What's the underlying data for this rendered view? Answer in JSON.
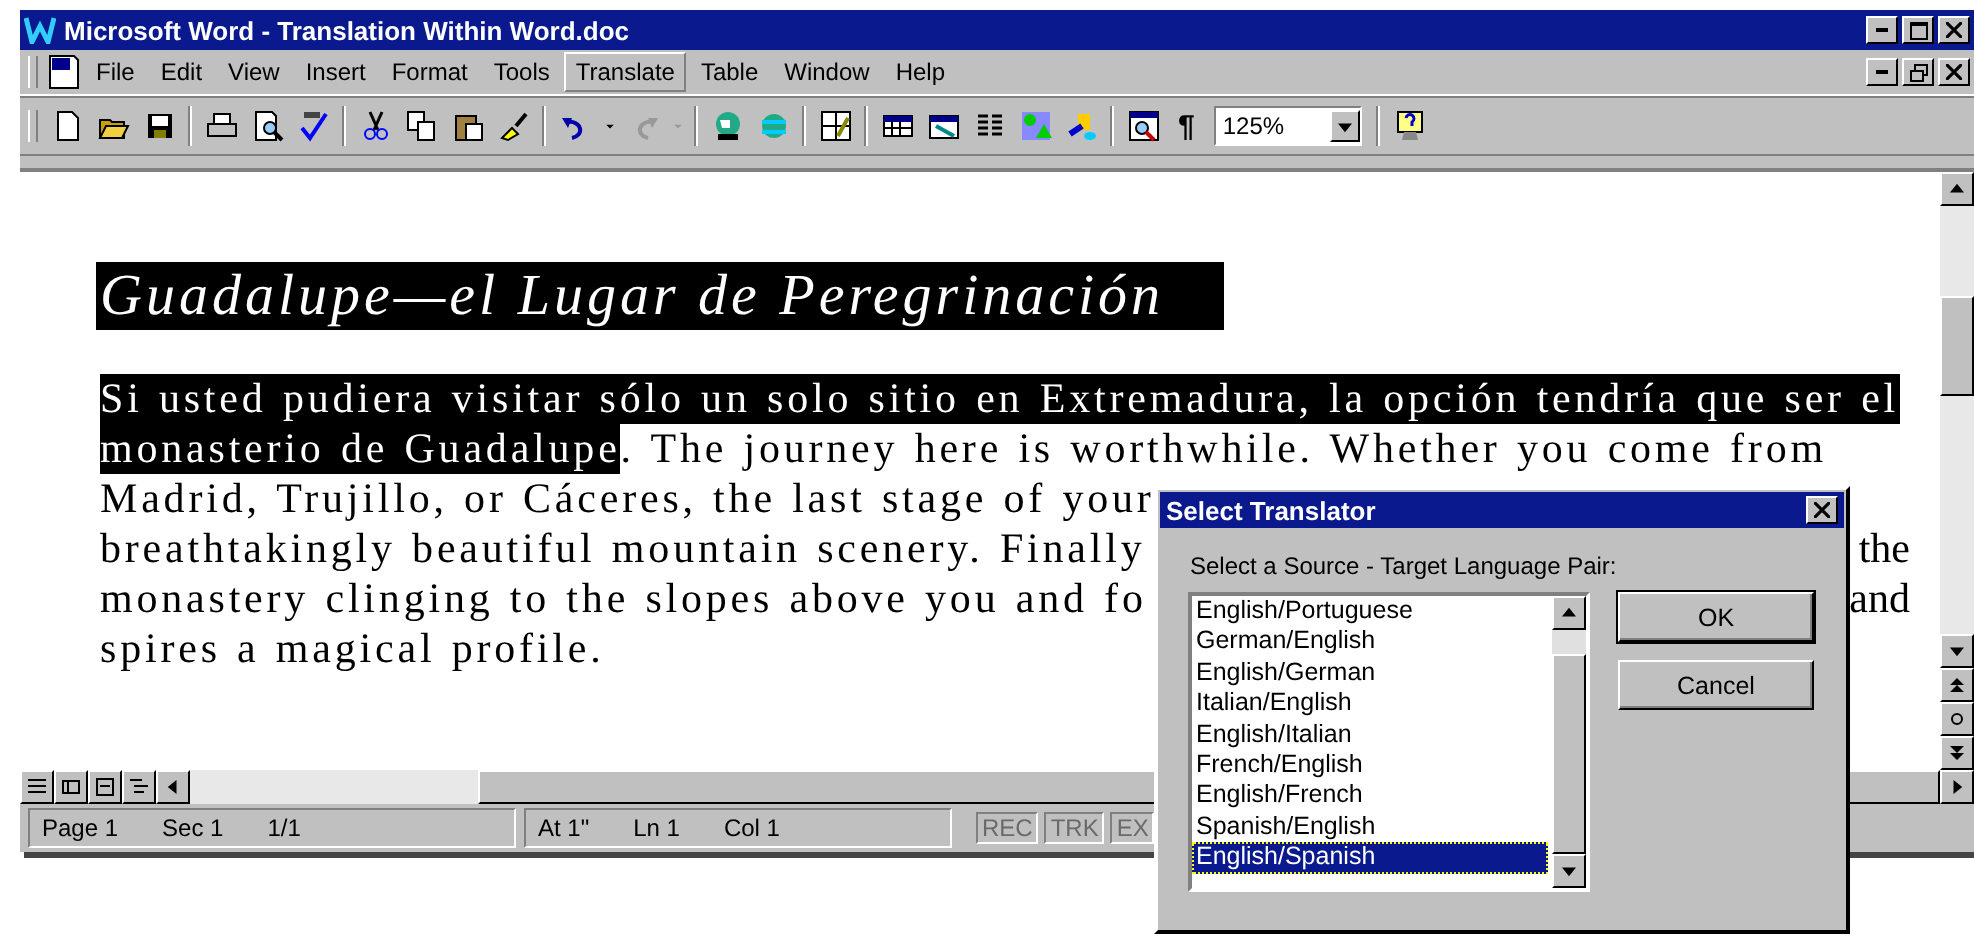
{
  "window": {
    "title": "Microsoft Word - Translation Within Word.doc"
  },
  "menu": [
    {
      "label": "File",
      "selected": false
    },
    {
      "label": "Edit",
      "selected": false
    },
    {
      "label": "View",
      "selected": false
    },
    {
      "label": "Insert",
      "selected": false
    },
    {
      "label": "Format",
      "selected": false
    },
    {
      "label": "Tools",
      "selected": false
    },
    {
      "label": "Translate",
      "selected": true
    },
    {
      "label": "Table",
      "selected": false
    },
    {
      "label": "Window",
      "selected": false
    },
    {
      "label": "Help",
      "selected": false
    }
  ],
  "toolbar": {
    "show_formatting": "¶",
    "zoom": "125%"
  },
  "document": {
    "heading": "Guadalupe—el Lugar de Peregrinación",
    "lines": [
      {
        "segments": [
          {
            "text": "Si usted pudiera visitar sólo un solo sitio en Extremadura, la opción tendría que ser el",
            "selected": true
          }
        ]
      },
      {
        "segments": [
          {
            "text": "monasterio de Guadalupe",
            "selected": true
          },
          {
            "text": ". The journey here is worthwhile. Whether you come from",
            "selected": false
          }
        ]
      },
      {
        "segments": [
          {
            "text": "Madrid, Trujillo, or Cáceres, the last stage of your",
            "selected": false
          }
        ]
      },
      {
        "segments": [
          {
            "text": "breathtakingly beautiful mountain scenery. Finally",
            "selected": false
          }
        ],
        "right": "the"
      },
      {
        "segments": [
          {
            "text": "monastery clinging to the slopes above you and fo",
            "selected": false
          }
        ],
        "right": "and"
      },
      {
        "segments": [
          {
            "text": "spires a magical profile.",
            "selected": false
          }
        ]
      }
    ]
  },
  "status_bar": {
    "position": [
      "Page 1",
      "Sec 1",
      "1/1"
    ],
    "cursor": [
      "At 1\"",
      "Ln 1",
      "Col 1"
    ],
    "modes": [
      {
        "text": "REC",
        "disabled": true
      },
      {
        "text": "TRK",
        "disabled": true
      },
      {
        "text": "EX",
        "disabled": true
      }
    ]
  },
  "dialog": {
    "title": "Select Translator",
    "label": "Select a Source - Target Language Pair:",
    "options": [
      {
        "label": "English/Portuguese",
        "selected": false
      },
      {
        "label": "German/English",
        "selected": false
      },
      {
        "label": "English/German",
        "selected": false
      },
      {
        "label": "Italian/English",
        "selected": false
      },
      {
        "label": "English/Italian",
        "selected": false
      },
      {
        "label": "French/English",
        "selected": false
      },
      {
        "label": "English/French",
        "selected": false
      },
      {
        "label": "Spanish/English",
        "selected": false
      },
      {
        "label": "English/Spanish",
        "selected": true
      }
    ],
    "buttons": [
      "OK",
      "Cancel"
    ]
  }
}
